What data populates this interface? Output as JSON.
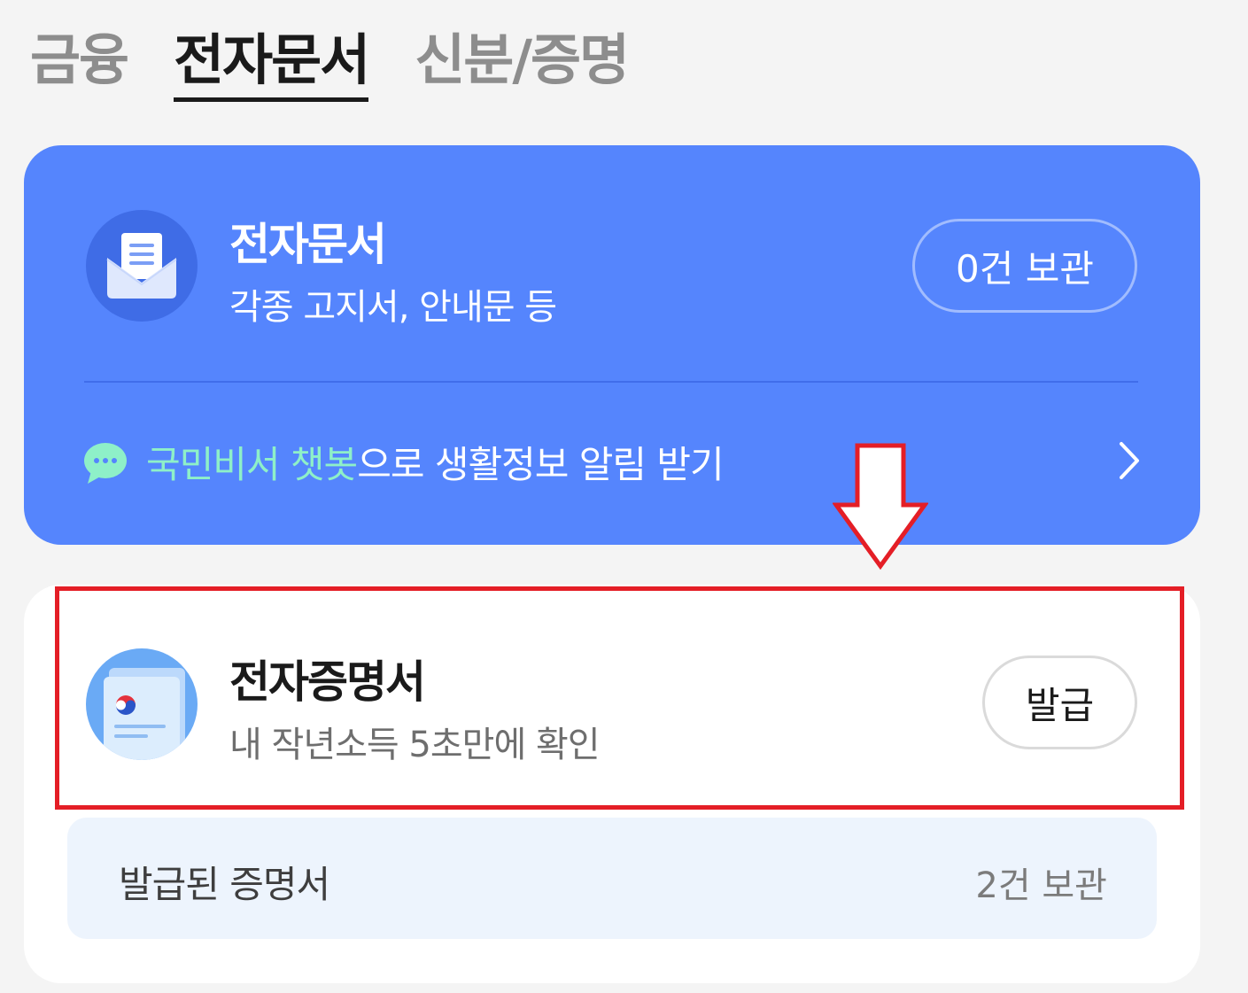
{
  "tabs": [
    {
      "label": "금융"
    },
    {
      "label": "전자문서"
    },
    {
      "label": "신분/증명"
    }
  ],
  "active_tab": "전자문서",
  "edoc_card": {
    "title": "전자문서",
    "subtitle": "각종 고지서, 안내문 등",
    "keep_button": "0건 보관",
    "chatbot_highlight": "국민비서 챗봇",
    "chatbot_rest": "으로 생활정보 알림 받기",
    "icon": "envelope-icon",
    "bg_color": "#5585fd",
    "highlight_color": "#8ef0c8"
  },
  "cert_card": {
    "title": "전자증명서",
    "subtitle": "내 작년소득 5초만에 확인",
    "issue_button": "발급",
    "issued_label": "발급된 증명서",
    "issued_count": "2건 보관",
    "icon": "certificate-icon"
  },
  "annotation": {
    "box_color": "#e41e26",
    "arrow": "down-arrow"
  }
}
